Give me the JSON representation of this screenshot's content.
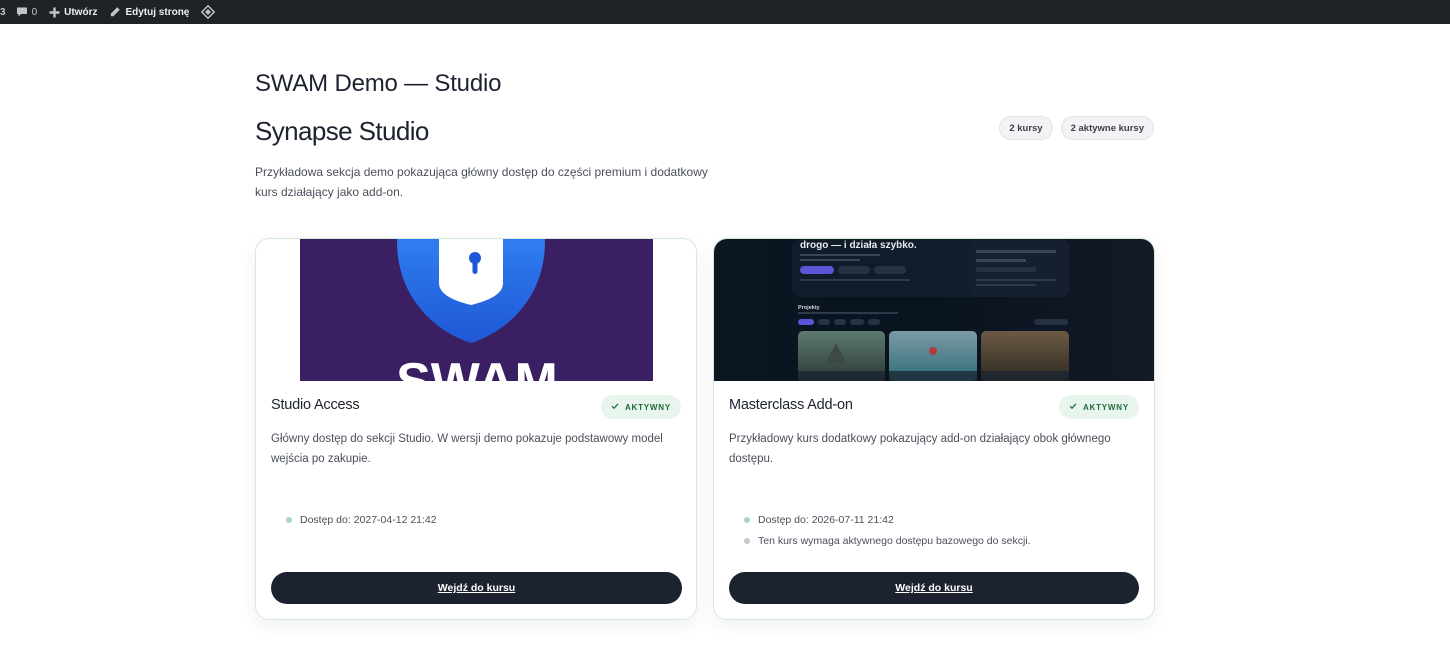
{
  "admin_bar": {
    "comments_count": "0",
    "new_label": "Utwórz",
    "edit_label": "Edytuj stronę"
  },
  "site_title": "SWAM Demo — Studio",
  "section": {
    "title": "Synapse Studio",
    "description": "Przykładowa sekcja demo pokazująca główny dostęp do części premium i dodatkowy kurs działający jako add-on.",
    "chips": [
      "2 kursy",
      "2 aktywne kursy"
    ]
  },
  "cards": [
    {
      "title": "Studio Access",
      "status": "AKTYWNY",
      "status_icon": "check-icon",
      "description": "Główny dostęp do sekcji Studio. W wersji demo pokazuje podstawowy model wejścia po zakupie.",
      "meta": [
        "Dostęp do: 2027-04-12 21:42"
      ],
      "thumbnail_text": "SWAM",
      "button_label": "Wejdź do kursu"
    },
    {
      "title": "Masterclass Add-on",
      "status": "AKTYWNY",
      "status_icon": "check-icon",
      "description": "Przykładowy kurs dodatkowy pokazujący add-on działający obok głównego dostępu.",
      "meta": [
        "Dostęp do: 2026-07-11 21:42",
        "Ten kurs wymaga aktywnego dostępu bazowego do sekcji."
      ],
      "thumbnail_text": "drogo — i działa szybko.",
      "thumbnail_subtext": "Projekty",
      "button_label": "Wejdź do kursu"
    }
  ],
  "colors": {
    "admin_bar": "#1d2327",
    "text_dark": "#1d2230",
    "badge_bg": "#e8f5ec",
    "badge_text": "#1f6b3c",
    "card_border": "#d5e9dc",
    "button_bg": "#1d2230",
    "swam_purple": "#3a1f63",
    "shield_blue": "#2a6fe8"
  }
}
